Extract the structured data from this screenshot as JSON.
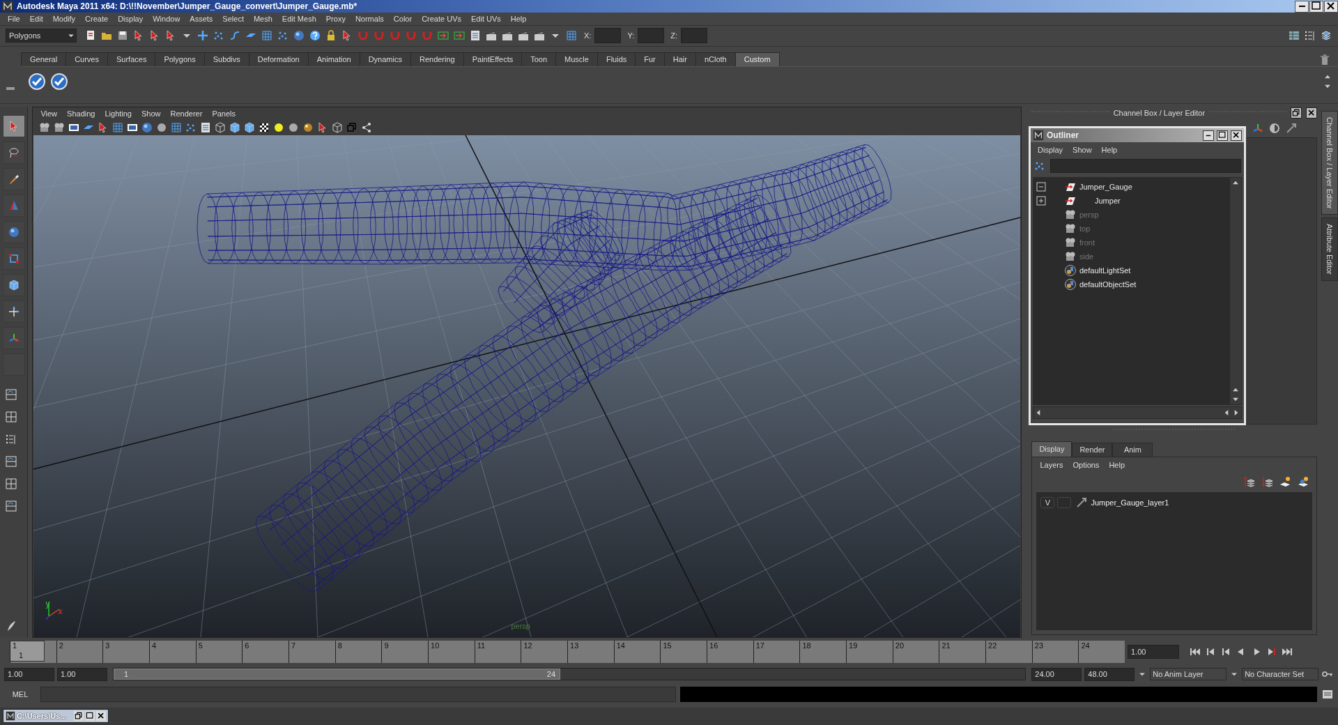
{
  "window": {
    "title": "Autodesk Maya 2011 x64: D:\\!!November\\Jumper_Gauge_convert\\Jumper_Gauge.mb*"
  },
  "menu_bar": [
    "File",
    "Edit",
    "Modify",
    "Create",
    "Display",
    "Window",
    "Assets",
    "Select",
    "Mesh",
    "Edit Mesh",
    "Proxy",
    "Normals",
    "Color",
    "Create UVs",
    "Edit UVs",
    "Help"
  ],
  "status_line": {
    "mode": "Polygons",
    "coord_labels": [
      "X:",
      "Y:",
      "Z:"
    ]
  },
  "shelf": {
    "tabs": [
      {
        "label": "General",
        "selected": false
      },
      {
        "label": "Curves",
        "selected": false
      },
      {
        "label": "Surfaces",
        "selected": false
      },
      {
        "label": "Polygons",
        "selected": false
      },
      {
        "label": "Subdivs",
        "selected": false
      },
      {
        "label": "Deformation",
        "selected": false
      },
      {
        "label": "Animation",
        "selected": false
      },
      {
        "label": "Dynamics",
        "selected": false
      },
      {
        "label": "Rendering",
        "selected": false
      },
      {
        "label": "PaintEffects",
        "selected": false
      },
      {
        "label": "Toon",
        "selected": false
      },
      {
        "label": "Muscle",
        "selected": false
      },
      {
        "label": "Fluids",
        "selected": false
      },
      {
        "label": "Fur",
        "selected": false
      },
      {
        "label": "Hair",
        "selected": false
      },
      {
        "label": "nCloth",
        "selected": false
      },
      {
        "label": "Custom",
        "selected": true
      }
    ]
  },
  "viewport": {
    "menu": [
      "View",
      "Shading",
      "Lighting",
      "Show",
      "Renderer",
      "Panels"
    ],
    "axis_labels": [
      "y",
      "x"
    ],
    "camera_label": "persp"
  },
  "channel_box": {
    "title": "Channel Box / Layer Editor"
  },
  "outliner": {
    "title": "Outliner",
    "menu": [
      "Display",
      "Show",
      "Help"
    ],
    "items": [
      {
        "name": "Jumper_Gauge",
        "kind": "transform",
        "expanded": true,
        "dimmed": false,
        "children": [
          {
            "name": "Jumper",
            "kind": "transform",
            "expanded": false,
            "dimmed": false
          }
        ]
      },
      {
        "name": "persp",
        "kind": "camera",
        "dimmed": true
      },
      {
        "name": "top",
        "kind": "camera",
        "dimmed": true
      },
      {
        "name": "front",
        "kind": "camera",
        "dimmed": true
      },
      {
        "name": "side",
        "kind": "camera",
        "dimmed": true
      },
      {
        "name": "defaultLightSet",
        "kind": "set",
        "dimmed": false
      },
      {
        "name": "defaultObjectSet",
        "kind": "set",
        "dimmed": false
      }
    ]
  },
  "layer_editor": {
    "tabs": [
      {
        "label": "Display",
        "selected": true
      },
      {
        "label": "Render",
        "selected": false
      },
      {
        "label": "Anim",
        "selected": false
      }
    ],
    "menu": [
      "Layers",
      "Options",
      "Help"
    ],
    "layers": [
      {
        "visibility": "V",
        "name": "Jumper_Gauge_layer1"
      }
    ]
  },
  "side_tabs": [
    {
      "label": "Channel Box / Layer Editor",
      "selected": true
    },
    {
      "label": "Attribute Editor",
      "selected": false
    }
  ],
  "time_slider": {
    "frames": [
      "1",
      "2",
      "3",
      "4",
      "5",
      "6",
      "7",
      "8",
      "9",
      "10",
      "11",
      "12",
      "13",
      "14",
      "15",
      "16",
      "17",
      "18",
      "19",
      "20",
      "21",
      "22",
      "23",
      "24"
    ],
    "current_frame": "1",
    "level": 0,
    "current_time": "1.00"
  },
  "range_slider": {
    "start_time": "1.00",
    "range_start": "1.00",
    "level": 0.49,
    "bar_start": "1",
    "bar_end": "24",
    "range_end": "24.00",
    "end_time": "48.00",
    "anim_layer": "No Anim Layer",
    "character_set": "No Character Set"
  },
  "command_line": {
    "label": "MEL"
  },
  "taskbar": {
    "window": "C:\\Users\\Us..."
  }
}
